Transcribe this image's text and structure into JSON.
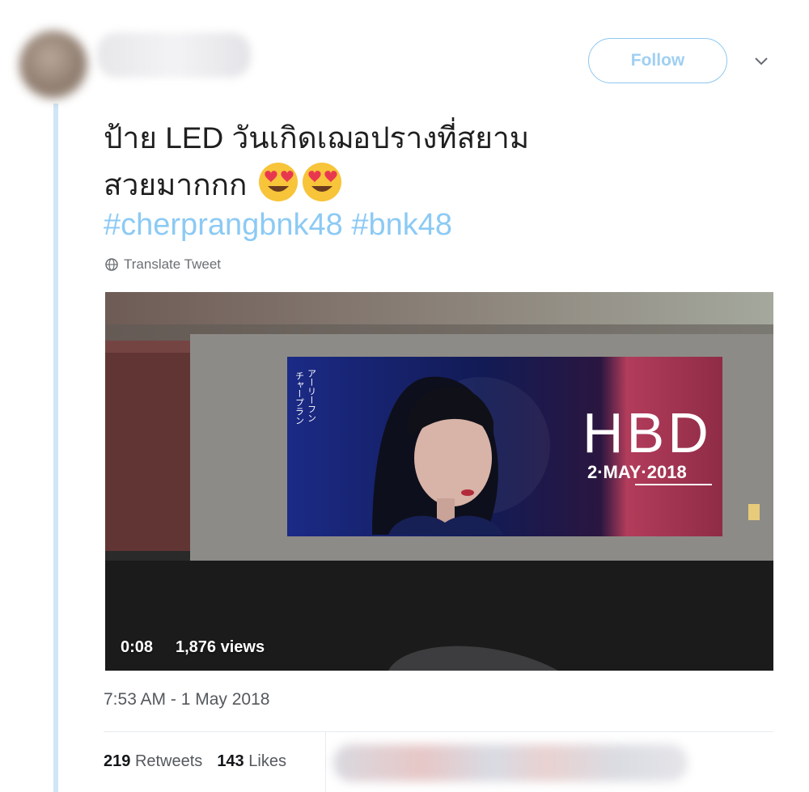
{
  "header": {
    "follow_label": "Follow",
    "caret_icon": "chevron-down-icon"
  },
  "tweet": {
    "text_line1": "ป้าย LED วันเกิดเฌอปรางที่สยาม",
    "text_line2": "สวยมากกก",
    "emojis": [
      "heart-eyes-emoji",
      "heart-eyes-emoji"
    ],
    "hashtags": [
      "#cherprangbnk48",
      "#bnk48"
    ],
    "translate_label": "Translate Tweet",
    "translate_icon": "globe-icon"
  },
  "video": {
    "screen_vertical_text_1": "アーリーフン",
    "screen_vertical_text_2": "チャープラン",
    "screen_title": "HBD",
    "screen_date": "2·MAY·2018",
    "time": "0:08",
    "views": "1,876 views"
  },
  "meta": {
    "timestamp": "7:53 AM - 1 May 2018"
  },
  "stats": {
    "retweets_count": "219",
    "retweets_label": "Retweets",
    "likes_count": "143",
    "likes_label": "Likes"
  },
  "colors": {
    "accent": "#1da1f2",
    "hashtag": "#8ccaf4",
    "thread_line": "#cfe6f7",
    "muted_text": "#55595e"
  }
}
